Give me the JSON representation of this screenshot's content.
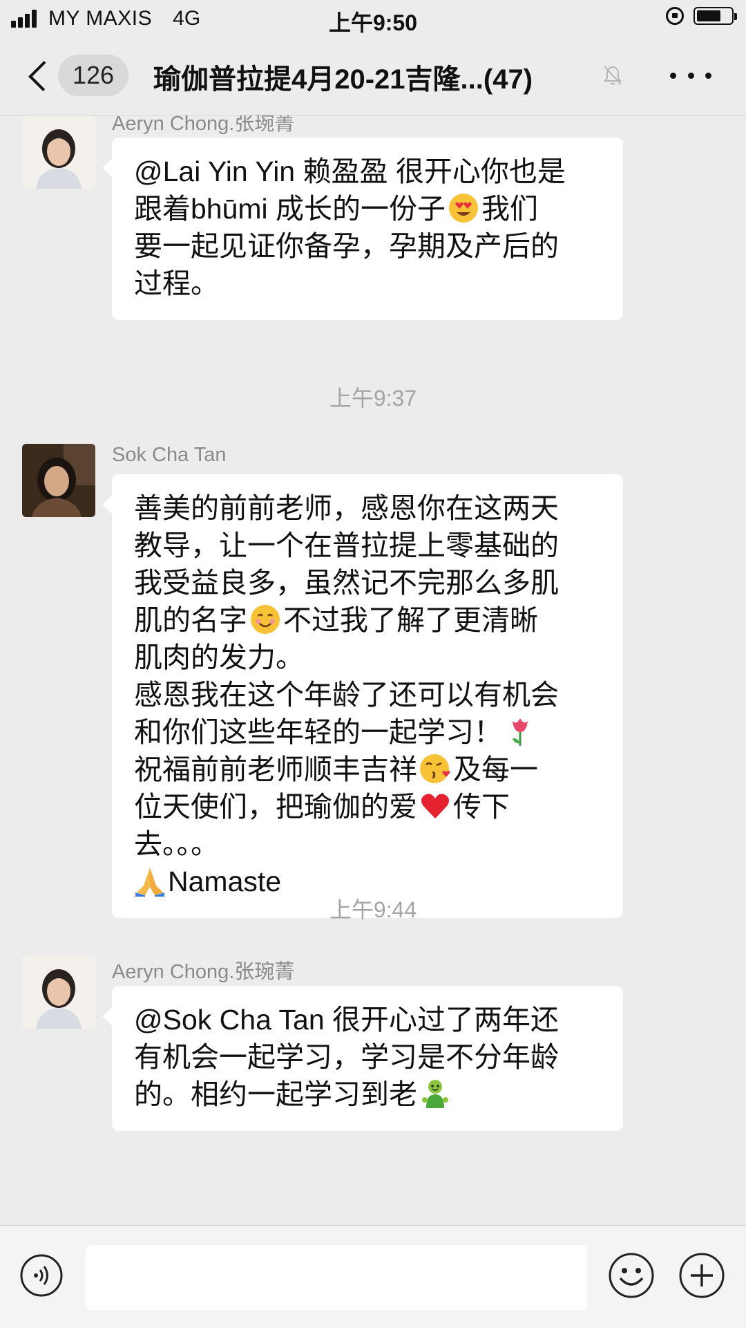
{
  "status_bar": {
    "carrier": "MY MAXIS",
    "network": "4G",
    "time": "上午9:50"
  },
  "nav": {
    "unread_count": "126",
    "title": "瑜伽普拉提4月20-21吉隆...(47)"
  },
  "messages": [
    {
      "sender": "Aeryn Chong.张琬菁",
      "lines": [
        [
          "@Lai Yin Yin 赖盈盈 很开心你也是"
        ],
        [
          "跟着bhūmi 成长的一份子",
          "smiling-face-with-heart-eyes-emoji",
          "我们"
        ],
        [
          "要一起见证你备孕，孕期及产后的"
        ],
        [
          "过程。"
        ]
      ]
    },
    {
      "sender": "Sok Cha Tan",
      "lines": [
        [
          "善美的前前老师，感恩你在这两天"
        ],
        [
          "教导，让一个在普拉提上零基础的"
        ],
        [
          "我受益良多，虽然记不完那么多肌"
        ],
        [
          "肌的名字",
          "smiling-face-emoji",
          "不过我了解了更清晰"
        ],
        [
          "肌肉的发力。"
        ],
        [
          "感恩我在这个年龄了还可以有机会"
        ],
        [
          "和你们这些年轻的一起学习！",
          "tulip-emoji"
        ],
        [
          "祝福前前老师顺丰吉祥",
          "face-blowing-kiss-emoji",
          "及每一"
        ],
        [
          "位天使们，把瑜伽的爱",
          "red-heart-emoji",
          "传下"
        ],
        [
          "去。。。"
        ],
        [
          "",
          "folded-hands-emoji",
          "Namaste"
        ]
      ]
    },
    {
      "sender": "Aeryn Chong.张琬菁",
      "lines": [
        [
          "@Sok Cha Tan 很开心过了两年还"
        ],
        [
          "有机会一起学习，学习是不分年龄"
        ],
        [
          "的。相约一起学习到老",
          "green-figure-emoji"
        ]
      ]
    }
  ],
  "timestamps": [
    "上午9:37",
    "上午9:44"
  ],
  "input": {
    "value": ""
  },
  "colors": {
    "background": "#ececec",
    "bubble": "#ffffff",
    "sender_name": "#8a8a8a",
    "timestamp": "#a4a4a4"
  }
}
